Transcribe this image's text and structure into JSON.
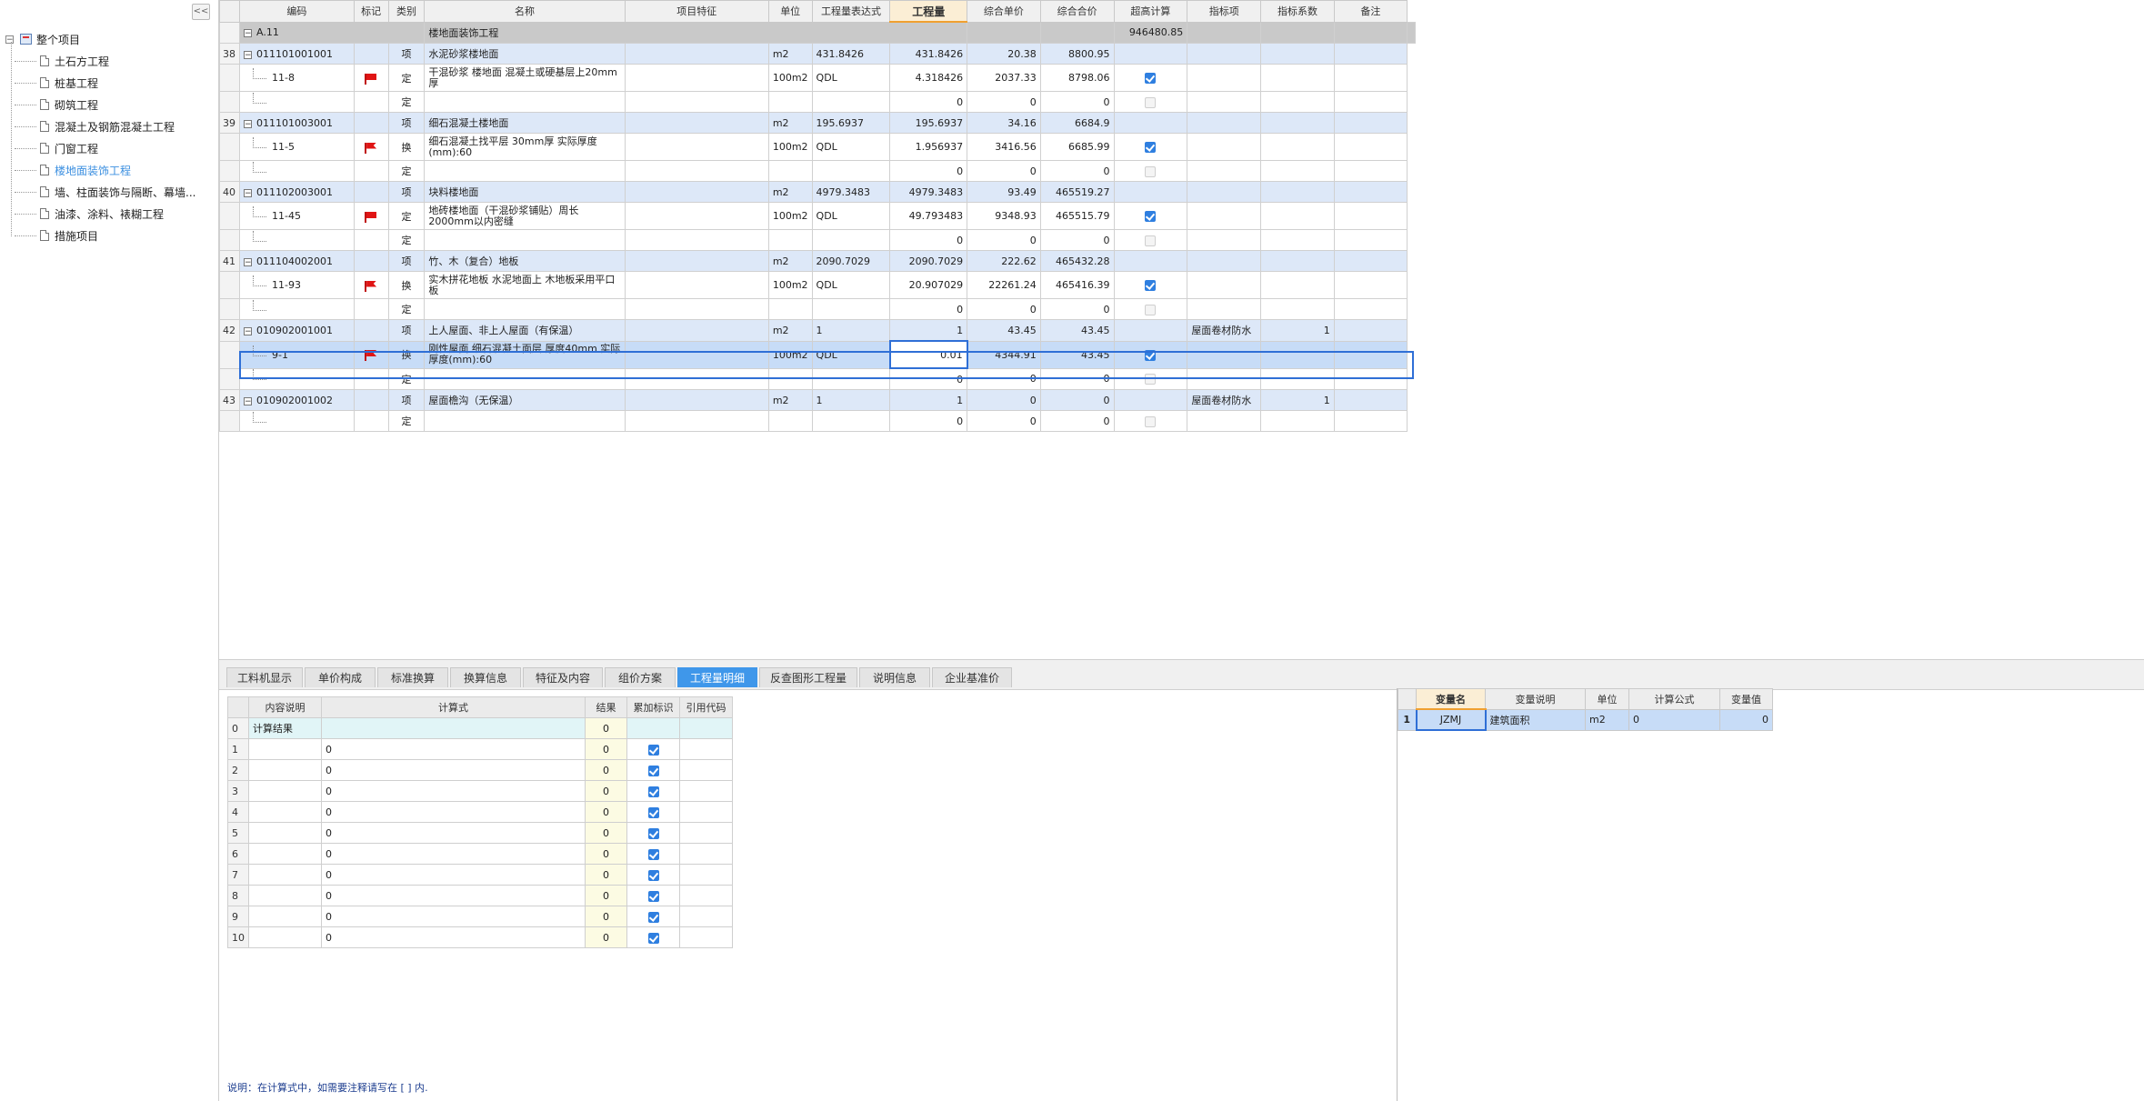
{
  "sidebar": {
    "collapse_label": "<<",
    "root": {
      "label": "整个项目",
      "toggle": "−"
    },
    "items": [
      {
        "label": "土石方工程"
      },
      {
        "label": "桩基工程"
      },
      {
        "label": "砌筑工程"
      },
      {
        "label": "混凝土及钢筋混凝土工程"
      },
      {
        "label": "门窗工程"
      },
      {
        "label": "楼地面装饰工程",
        "active": true
      },
      {
        "label": "墙、柱面装饰与隔断、幕墙..."
      },
      {
        "label": "油漆、涂料、裱糊工程"
      },
      {
        "label": "措施项目"
      }
    ]
  },
  "grid": {
    "headers": [
      "编码",
      "标记",
      "类别",
      "名称",
      "项目特征",
      "单位",
      "工程量表达式",
      "工程量",
      "综合单价",
      "综合合价",
      "超高计算",
      "指标项",
      "指标系数",
      "备注"
    ],
    "section": {
      "code": "A.11",
      "toggle": "−",
      "name": "楼地面装饰工程",
      "total": "946480.85"
    },
    "rows": [
      {
        "type": "item",
        "no": "38",
        "code": "011101001001",
        "cat": "项",
        "name": "水泥砂浆楼地面",
        "unit": "m2",
        "expr": "431.8426",
        "qty": "431.8426",
        "price": "20.38",
        "total": "8800.95"
      },
      {
        "type": "sub",
        "code": "11-8",
        "flag": "plain",
        "cat": "定",
        "name": "干混砂浆 楼地面 混凝土或硬基层上20mm厚",
        "unit": "100m2",
        "expr": "QDL",
        "qty": "4.318426",
        "price": "2037.33",
        "total": "8798.06",
        "check": true
      },
      {
        "type": "empty",
        "cat": "定",
        "qty": "0",
        "price": "0",
        "total": "0"
      },
      {
        "type": "item",
        "no": "39",
        "code": "011101003001",
        "cat": "项",
        "name": "细石混凝土楼地面",
        "unit": "m2",
        "expr": "195.6937",
        "qty": "195.6937",
        "price": "34.16",
        "total": "6684.9"
      },
      {
        "type": "sub",
        "code": "11-5",
        "flag": "alt",
        "cat": "换",
        "name": "细石混凝土找平层 30mm厚  实际厚度(mm):60",
        "unit": "100m2",
        "expr": "QDL",
        "qty": "1.956937",
        "price": "3416.56",
        "total": "6685.99",
        "check": true
      },
      {
        "type": "empty",
        "cat": "定",
        "qty": "0",
        "price": "0",
        "total": "0"
      },
      {
        "type": "item",
        "no": "40",
        "code": "011102003001",
        "cat": "项",
        "name": "块料楼地面",
        "unit": "m2",
        "expr": "4979.3483",
        "qty": "4979.3483",
        "price": "93.49",
        "total": "465519.27"
      },
      {
        "type": "sub",
        "code": "11-45",
        "flag": "plain",
        "cat": "定",
        "name": "地砖楼地面（干混砂浆铺贴）周长2000mm以内密缝",
        "unit": "100m2",
        "expr": "QDL",
        "qty": "49.793483",
        "price": "9348.93",
        "total": "465515.79",
        "check": true
      },
      {
        "type": "empty",
        "cat": "定",
        "qty": "0",
        "price": "0",
        "total": "0"
      },
      {
        "type": "item",
        "no": "41",
        "code": "011104002001",
        "cat": "项",
        "name": "竹、木（复合）地板",
        "unit": "m2",
        "expr": "2090.7029",
        "qty": "2090.7029",
        "price": "222.62",
        "total": "465432.28"
      },
      {
        "type": "sub",
        "code": "11-93",
        "flag": "alt",
        "cat": "换",
        "name": "实木拼花地板 水泥地面上  木地板采用平口板",
        "unit": "100m2",
        "expr": "QDL",
        "qty": "20.907029",
        "price": "22261.24",
        "total": "465416.39",
        "check": true
      },
      {
        "type": "empty",
        "cat": "定",
        "qty": "0",
        "price": "0",
        "total": "0"
      },
      {
        "type": "item",
        "no": "42",
        "code": "010902001001",
        "cat": "项",
        "name": "上人屋面、非上人屋面（有保温）",
        "unit": "m2",
        "expr": "1",
        "qty": "1",
        "price": "43.45",
        "total": "43.45",
        "index_item": "屋面卷材防水",
        "index_coef": "1"
      },
      {
        "type": "sel",
        "code": "9-1",
        "flag": "alt",
        "cat": "换",
        "name": "刚性屋面 细石混凝土面层 厚度40mm  实际厚度(mm):60",
        "unit": "100m2",
        "expr": "QDL",
        "qty": "0.01",
        "price": "4344.91",
        "total": "43.45",
        "check": true
      },
      {
        "type": "empty",
        "cat": "定",
        "qty": "0",
        "price": "0",
        "total": "0"
      },
      {
        "type": "item",
        "no": "43",
        "code": "010902001002",
        "cat": "项",
        "name": "屋面檐沟（无保温）",
        "unit": "m2",
        "expr": "1",
        "qty": "1",
        "price": "0",
        "total": "0",
        "index_item": "屋面卷材防水",
        "index_coef": "1"
      },
      {
        "type": "empty",
        "cat": "定",
        "qty": "0",
        "price": "0",
        "total": "0"
      }
    ]
  },
  "tabs": [
    {
      "label": "工料机显示"
    },
    {
      "label": "单价构成"
    },
    {
      "label": "标准换算"
    },
    {
      "label": "换算信息"
    },
    {
      "label": "特征及内容"
    },
    {
      "label": "组价方案"
    },
    {
      "label": "工程量明细",
      "active": true
    },
    {
      "label": "反查图形工程量"
    },
    {
      "label": "说明信息"
    },
    {
      "label": "企业基准价"
    }
  ],
  "calc": {
    "headers": [
      "内容说明",
      "计算式",
      "结果",
      "累加标识",
      "引用代码"
    ],
    "rows": [
      {
        "idx": "0",
        "desc": "计算结果",
        "formula": "",
        "result": "0",
        "check": false
      },
      {
        "idx": "1",
        "desc": "",
        "formula": "0",
        "result": "0",
        "check": true
      },
      {
        "idx": "2",
        "desc": "",
        "formula": "0",
        "result": "0",
        "check": true
      },
      {
        "idx": "3",
        "desc": "",
        "formula": "0",
        "result": "0",
        "check": true
      },
      {
        "idx": "4",
        "desc": "",
        "formula": "0",
        "result": "0",
        "check": true
      },
      {
        "idx": "5",
        "desc": "",
        "formula": "0",
        "result": "0",
        "check": true
      },
      {
        "idx": "6",
        "desc": "",
        "formula": "0",
        "result": "0",
        "check": true
      },
      {
        "idx": "7",
        "desc": "",
        "formula": "0",
        "result": "0",
        "check": true
      },
      {
        "idx": "8",
        "desc": "",
        "formula": "0",
        "result": "0",
        "check": true
      },
      {
        "idx": "9",
        "desc": "",
        "formula": "0",
        "result": "0",
        "check": true
      },
      {
        "idx": "10",
        "desc": "",
        "formula": "0",
        "result": "0",
        "check": true
      }
    ],
    "note": "说明：在计算式中，如需要注释请写在 [ ] 内."
  },
  "vars": {
    "headers": [
      "变量名",
      "变量说明",
      "单位",
      "计算公式",
      "变量值"
    ],
    "rows": [
      {
        "idx": "1",
        "name": "JZMJ",
        "desc": "建筑面积",
        "unit": "m2",
        "formula": "0",
        "value": "0"
      }
    ]
  },
  "colors": {
    "accent": "#3f97ea",
    "selection": "#c7dcf7",
    "item_row": "#dde8f8",
    "section_row": "#c9c9c9",
    "flag": "#e01515"
  }
}
